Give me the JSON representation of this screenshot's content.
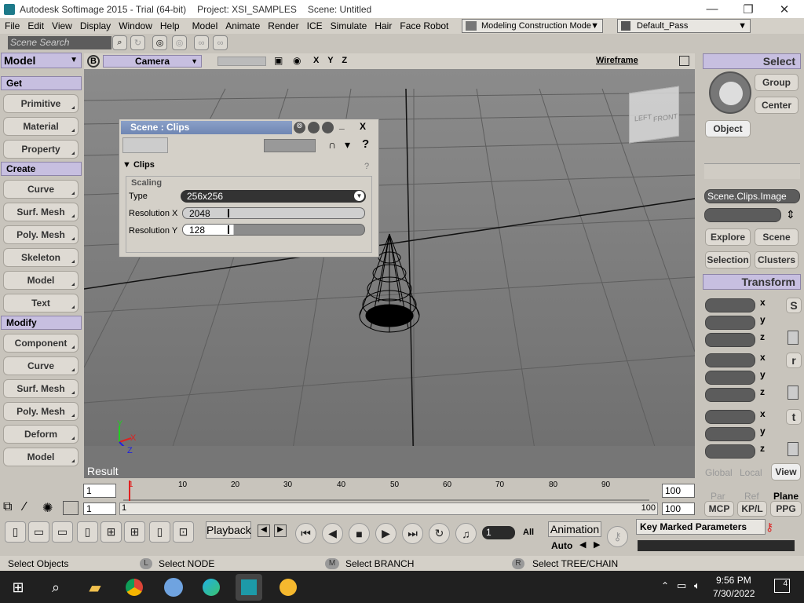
{
  "window": {
    "app_title": "Autodesk Softimage 2015 - Trial (64-bit)",
    "project": "Project: XSI_SAMPLES",
    "scene": "Scene: Untitled",
    "minimize": "—",
    "restore": "❐",
    "close": "✕"
  },
  "menu": {
    "items": [
      "File",
      "Edit",
      "View",
      "Display",
      "Window",
      "Help",
      "Model",
      "Animate",
      "Render",
      "ICE",
      "Simulate",
      "Hair",
      "Face Robot"
    ],
    "mode": "Modeling Construction Mode",
    "pass": "Default_Pass"
  },
  "toolbar": {
    "search_placeholder": "Scene Search"
  },
  "left_panel": {
    "mode": "Model",
    "sections": [
      {
        "title": "Get",
        "items": [
          "Primitive",
          "Material",
          "Property"
        ]
      },
      {
        "title": "Create",
        "items": [
          "Curve",
          "Surf. Mesh",
          "Poly. Mesh",
          "Skeleton",
          "Model",
          "Text"
        ]
      },
      {
        "title": "Modify",
        "items": [
          "Component",
          "Curve",
          "Surf. Mesh",
          "Poly. Mesh",
          "Deform",
          "Model"
        ]
      }
    ]
  },
  "viewport": {
    "letter": "B",
    "camera": "Camera",
    "axes": "X Y Z",
    "display_mode": "Wireframe",
    "result_label": "Result",
    "cube_left": "LEFT",
    "cube_front": "FRONT",
    "axis_x": "X",
    "axis_y": "Y",
    "axis_z": "Z"
  },
  "dialog": {
    "title": "Scene : Clips",
    "close": "X",
    "minimize": "_",
    "section": "Clips",
    "group": "Scaling",
    "type_label": "Type",
    "type_value": "256x256",
    "res_x_label": "Resolution X",
    "res_x_value": "2048",
    "res_y_label": "Resolution Y",
    "res_y_value": "128",
    "help": "?"
  },
  "right_panel": {
    "select_header": "Select",
    "group": "Group",
    "center": "Center",
    "object": "Object",
    "selection_field": "Scene.Clips.Image",
    "explore": "Explore",
    "scene": "Scene",
    "selection": "Selection",
    "clusters": "Clusters",
    "transform_header": "Transform",
    "scale_icon": "S",
    "rotate_icon": "r",
    "translate_icon": "t",
    "axis_x": "x",
    "axis_y": "y",
    "axis_z": "z",
    "global": "Global",
    "local": "Local",
    "view": "View",
    "par": "Par",
    "ref": "Ref",
    "plane": "Plane",
    "mcp": "MCP",
    "kpl": "KP/L",
    "ppg": "PPG"
  },
  "timeline": {
    "start": "1",
    "end": "100",
    "ticks": [
      "1",
      "10",
      "20",
      "30",
      "40",
      "50",
      "60",
      "70",
      "80",
      "90"
    ],
    "range_start": "1",
    "range_start2": "1",
    "range_end": "100",
    "range_end2": "100",
    "range_end_right": "100"
  },
  "playback": {
    "playback_label": "Playback",
    "frame": "1",
    "all": "All",
    "animation": "Animation",
    "auto": "Auto",
    "key_marked": "Key Marked Parameters"
  },
  "status": {
    "left": "Select Objects",
    "l_key": "L",
    "l_text": "Select NODE",
    "m_key": "M",
    "m_text": "Select BRANCH",
    "r_key": "R",
    "r_text": "Select TREE/CHAIN"
  },
  "taskbar": {
    "time": "9:56 PM",
    "date": "7/30/2022",
    "notifications": "4"
  }
}
